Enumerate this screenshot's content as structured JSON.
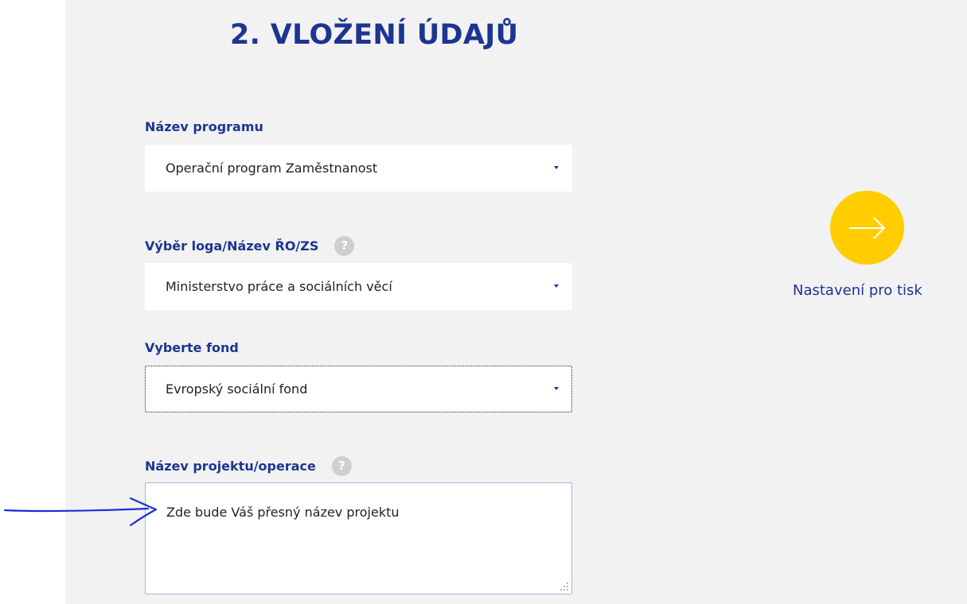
{
  "page": {
    "heading": "2. VLOŽENÍ ÚDAJŮ"
  },
  "form": {
    "program": {
      "label": "Název programu",
      "value": "Operační program Zaměstnanost"
    },
    "logo": {
      "label": "Výběr loga/Název ŘO/ZS",
      "help": "?",
      "value": "Ministerstvo práce a sociálních věcí"
    },
    "fund": {
      "label": "Vyberte fond",
      "value": "Evropský sociální fond"
    },
    "project": {
      "label": "Název projektu/operace",
      "help": "?",
      "value": "Zde bude Váš přesný název projektu"
    }
  },
  "print": {
    "label": "Nastavení pro tisk",
    "icon": "arrow-right-icon",
    "accent": "#ffcd00"
  },
  "colors": {
    "primary": "#1d3590",
    "panel": "#f2f2f2",
    "annotation": "#1a2fd8"
  }
}
